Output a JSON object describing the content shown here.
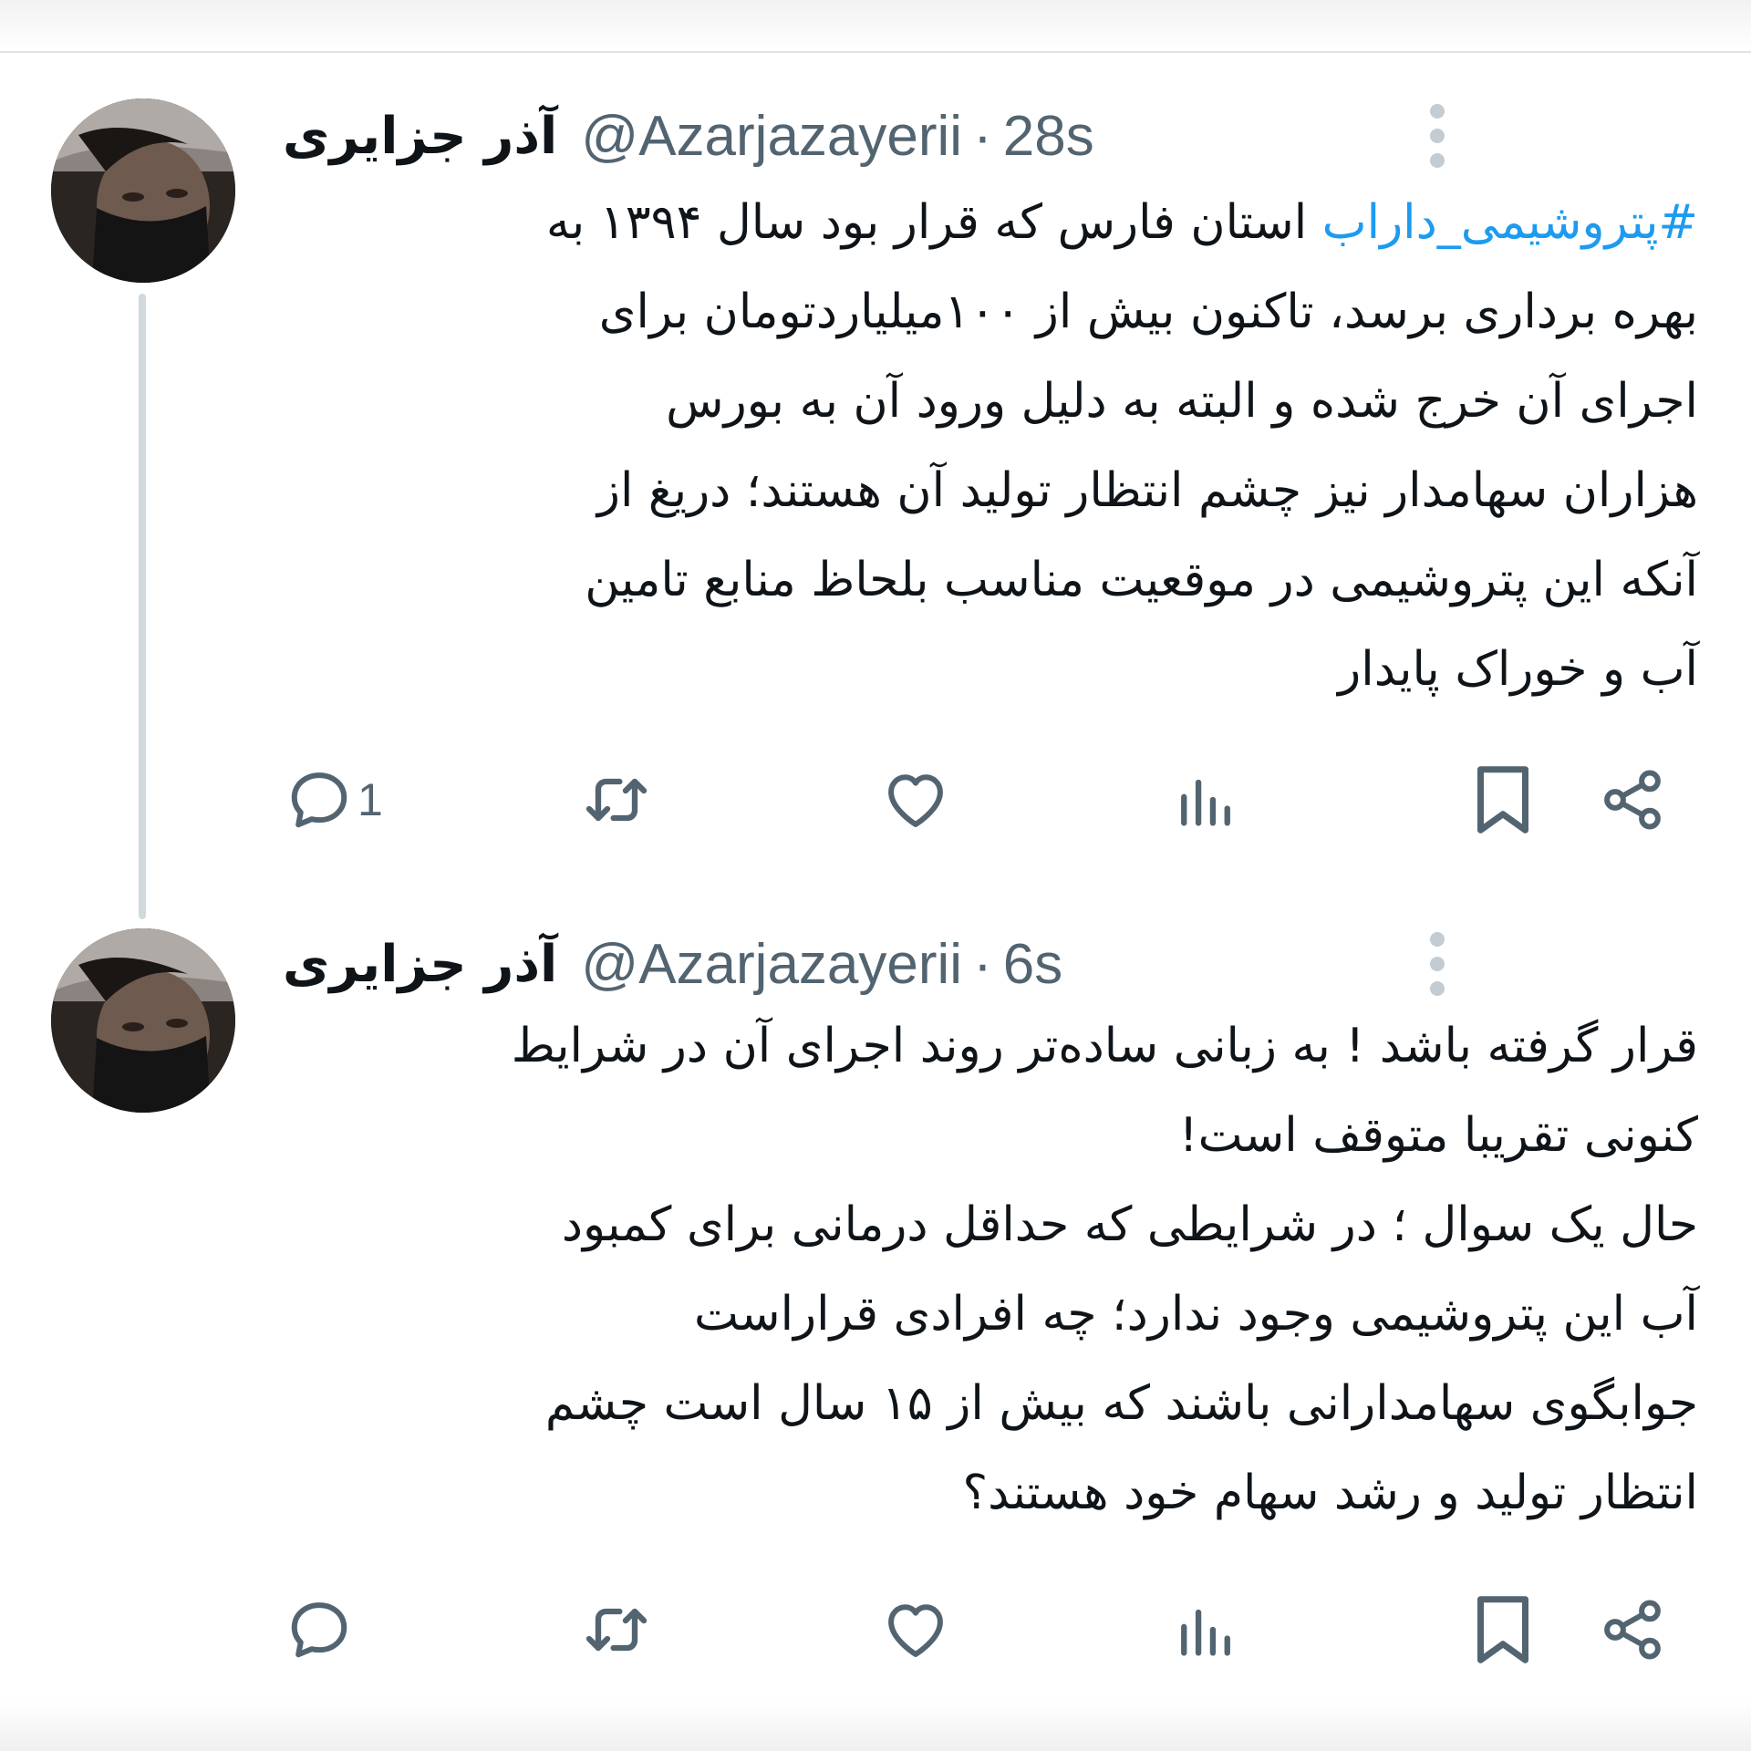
{
  "tweets": [
    {
      "display_name": "آذر جزایری",
      "handle": "@Azarjazayerii",
      "separator": "·",
      "time": "28s",
      "hashtag": "#پتروشیمی_داراب",
      "first_line_rest": " استان فارس که قرار بود سال ۱۳۹۴ به",
      "lines": [
        "بهره برداری برسد، تاکنون بیش از ۱۰۰میلیاردتومان برای",
        "اجرای آن خرج شده و البته به دلیل ورود آن به بورس",
        "هزاران سهامدار نیز چشم انتظار تولید آن هستند؛ دریغ از",
        "آنکه این پتروشیمی در موقعیت مناسب بلحاظ منابع تامین",
        "آب و خوراک پایدار"
      ],
      "actions": {
        "reply_count": "1",
        "reply_icon": "reply-icon",
        "retweet_icon": "retweet-icon",
        "like_icon": "heart-icon",
        "views_icon": "views-icon",
        "bookmark_icon": "bookmark-icon",
        "share_icon": "share-icon"
      }
    },
    {
      "display_name": "آذر جزایری",
      "handle": "@Azarjazayerii",
      "separator": "·",
      "time": "6s",
      "lines": [
        "قرار گرفته باشد ! به زبانی ساده‌تر روند اجرای آن در شرایط",
        "کنونی تقریبا متوقف است!",
        "حال یک سوال ؛ در شرایطی که حداقل درمانی برای کمبود",
        "آب این پتروشیمی وجود ندارد؛ چه افرادی قراراست",
        "جوابگوی سهامدارانی باشند که بیش از ۱۵ سال است چشم",
        "انتظار تولید و رشد سهام خود هستند؟"
      ],
      "actions": {
        "reply_icon": "reply-icon",
        "retweet_icon": "retweet-icon",
        "like_icon": "heart-icon",
        "views_icon": "views-icon",
        "bookmark_icon": "bookmark-icon",
        "share_icon": "share-icon"
      }
    }
  ],
  "colors": {
    "text": "#0f1419",
    "secondary": "#536471",
    "hashtag": "#1d9bf0",
    "thread_line": "#cfd9de"
  }
}
